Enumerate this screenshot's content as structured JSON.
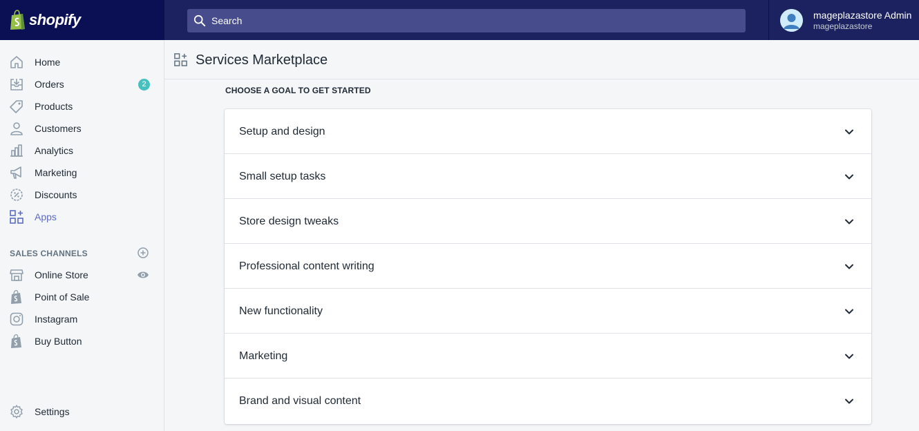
{
  "brand": {
    "name": "shopify"
  },
  "search": {
    "placeholder": "Search"
  },
  "user": {
    "name": "mageplazastore Admin",
    "store": "mageplazastore"
  },
  "sidebar": {
    "items": [
      {
        "label": "Home",
        "icon": "home-icon"
      },
      {
        "label": "Orders",
        "icon": "orders-icon",
        "badge": "2"
      },
      {
        "label": "Products",
        "icon": "tag-icon"
      },
      {
        "label": "Customers",
        "icon": "person-icon"
      },
      {
        "label": "Analytics",
        "icon": "bar-chart-icon"
      },
      {
        "label": "Marketing",
        "icon": "megaphone-icon"
      },
      {
        "label": "Discounts",
        "icon": "discount-icon"
      },
      {
        "label": "Apps",
        "icon": "apps-icon",
        "active": true
      }
    ],
    "sales_channels_title": "SALES CHANNELS",
    "channels": [
      {
        "label": "Online Store",
        "icon": "store-icon"
      },
      {
        "label": "Point of Sale",
        "icon": "shopify-bag-icon"
      },
      {
        "label": "Instagram",
        "icon": "instagram-icon"
      },
      {
        "label": "Buy Button",
        "icon": "shopify-bag-icon"
      }
    ],
    "settings_label": "Settings"
  },
  "page": {
    "title": "Services Marketplace",
    "goal_heading": "CHOOSE A GOAL TO GET STARTED",
    "goals": [
      "Setup and design",
      "Small setup tasks",
      "Store design tweaks",
      "Professional content writing",
      "New functionality",
      "Marketing",
      "Brand and visual content"
    ]
  },
  "colors": {
    "topbar": "#1c2260",
    "logo_bg": "#0b1054",
    "search_bg": "#474d8c",
    "accent": "#5c6ac4",
    "badge": "#47c1bf"
  }
}
